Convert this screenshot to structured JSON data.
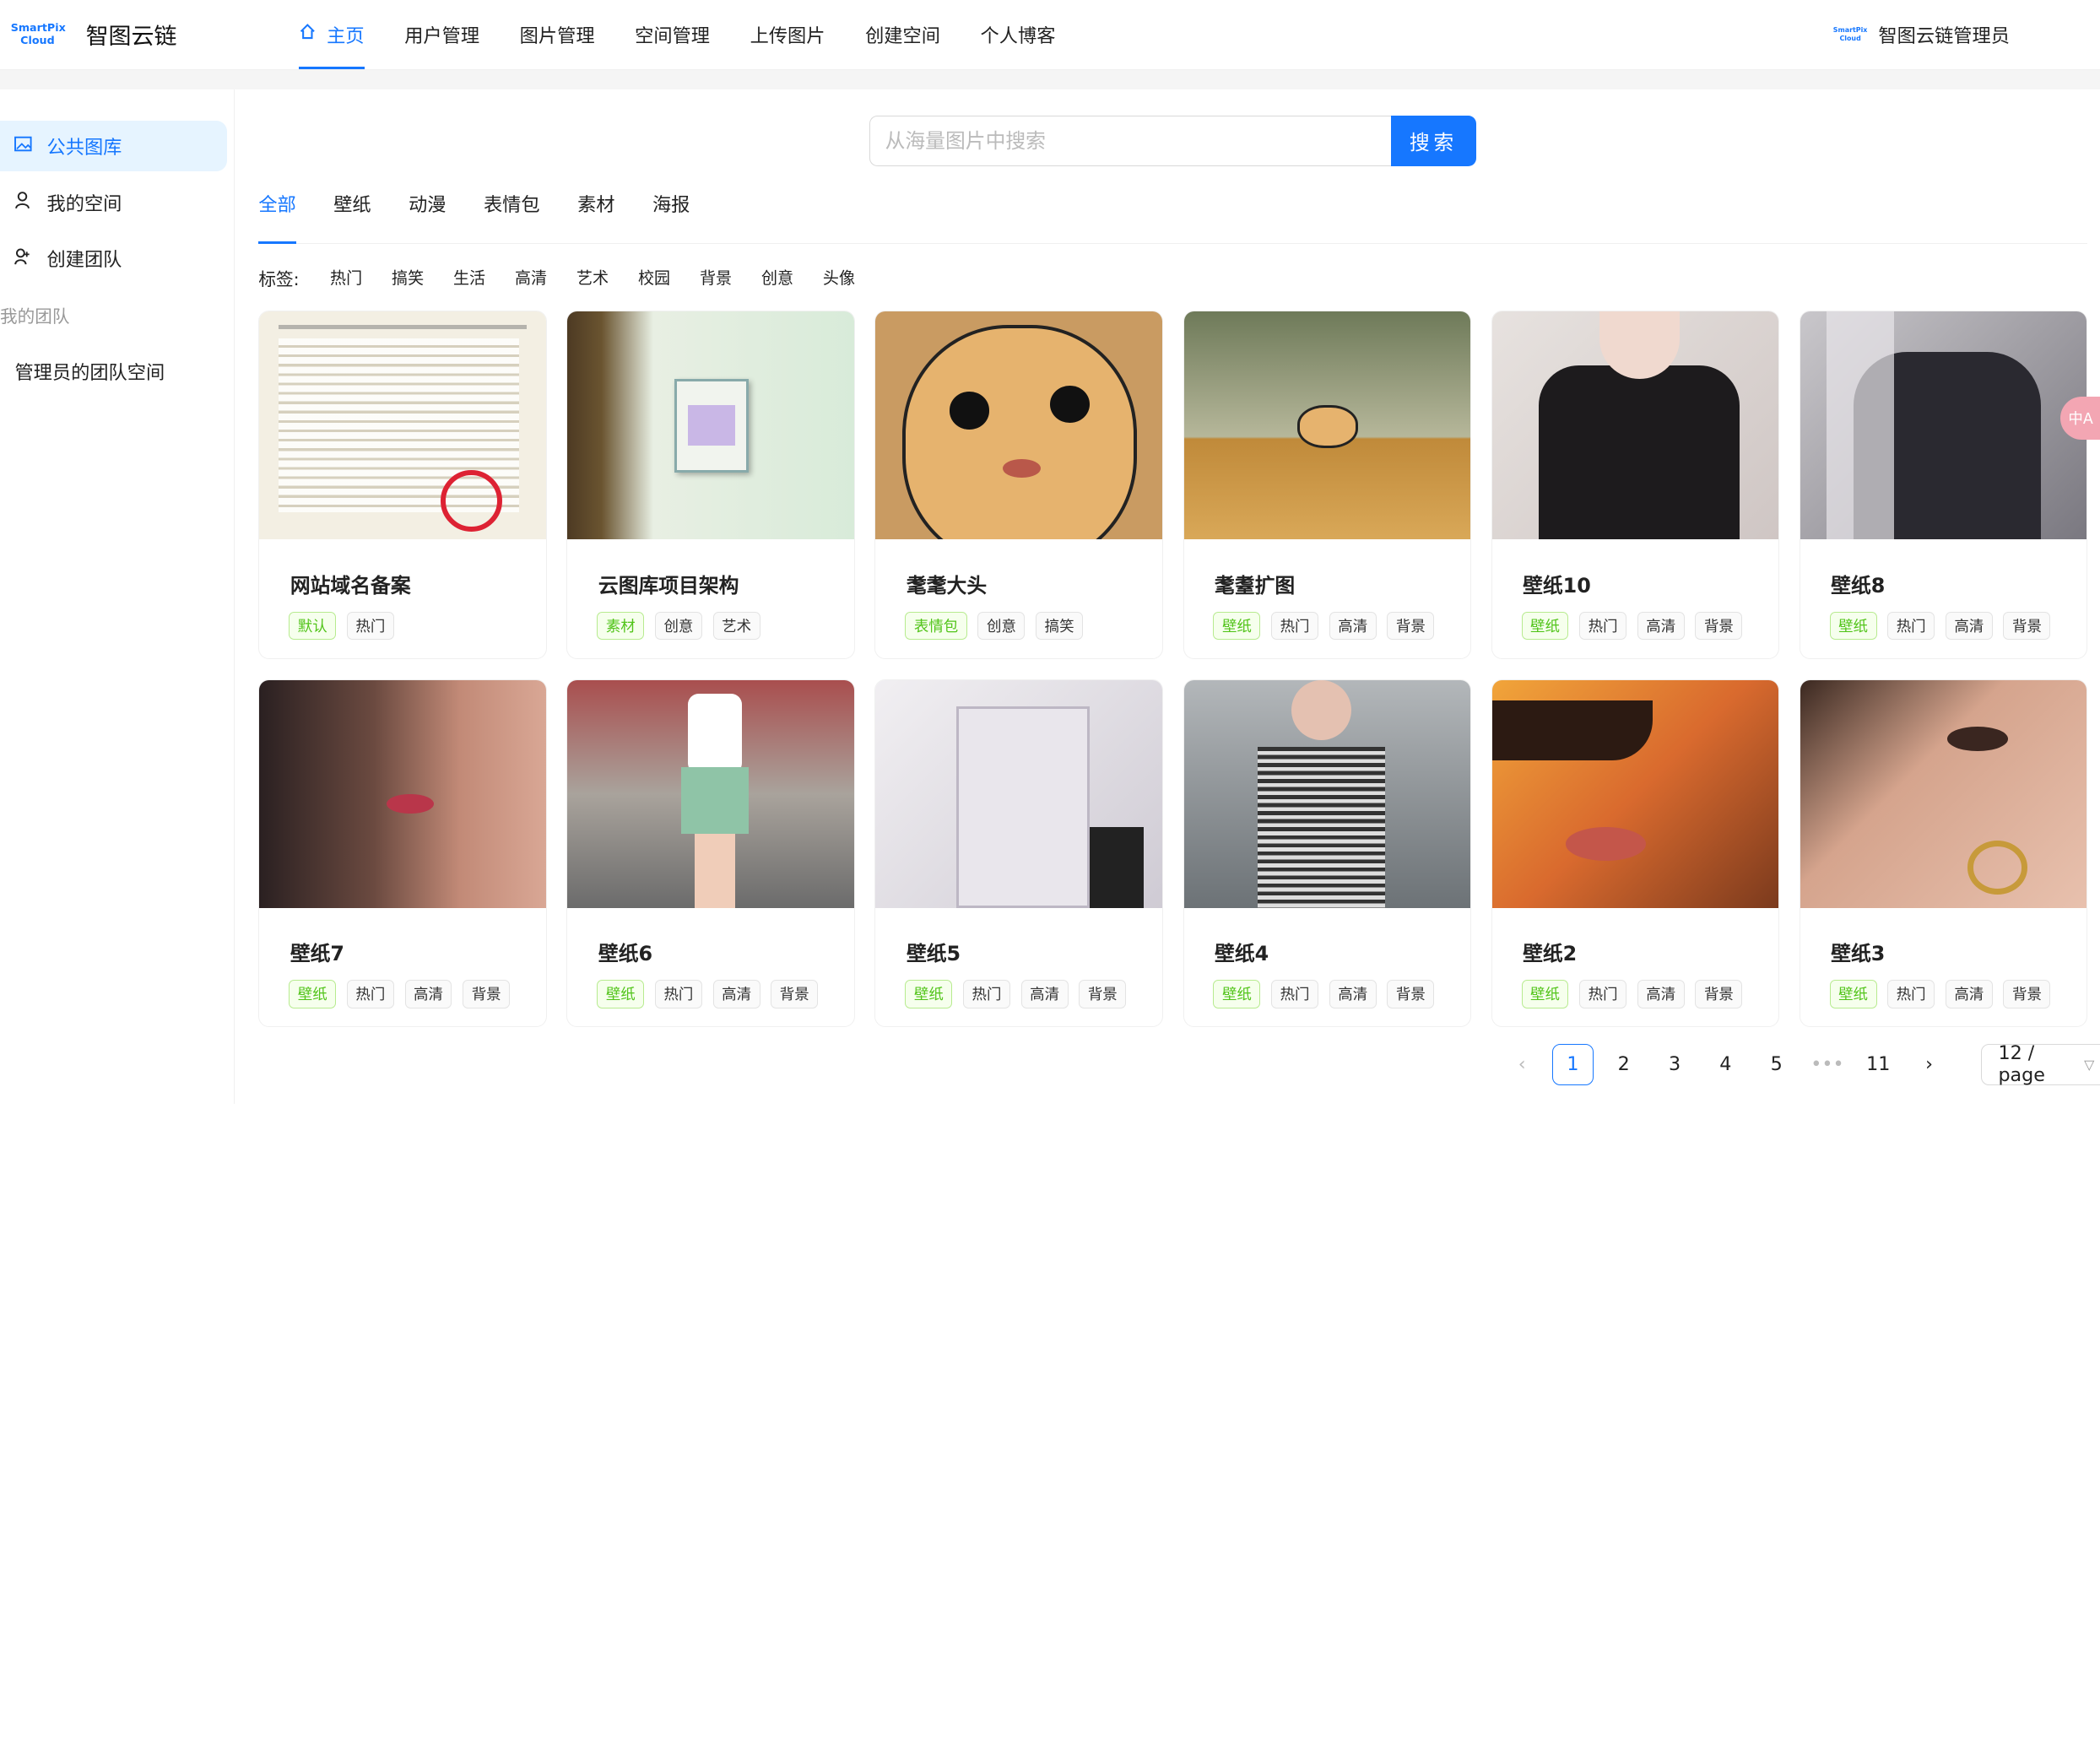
{
  "header": {
    "logo_text": "SmartPix Cloud",
    "brand": "智图云链",
    "nav": [
      {
        "label": "主页",
        "active": true
      },
      {
        "label": "用户管理"
      },
      {
        "label": "图片管理"
      },
      {
        "label": "空间管理"
      },
      {
        "label": "上传图片"
      },
      {
        "label": "创建空间"
      },
      {
        "label": "个人博客"
      }
    ],
    "user_logo_text": "SmartPix Cloud",
    "user_name": "智图云链管理员"
  },
  "sider": {
    "items": [
      {
        "label": "公共图库",
        "icon": "picture-icon",
        "active": true
      },
      {
        "label": "我的空间",
        "icon": "user-icon"
      },
      {
        "label": "创建团队",
        "icon": "team-icon"
      }
    ],
    "group_title": "我的团队",
    "group_items": [
      {
        "label": "管理员的团队空间"
      }
    ]
  },
  "search": {
    "placeholder": "从海量图片中搜索",
    "value": "",
    "button": "搜索"
  },
  "categories": [
    "全部",
    "壁纸",
    "动漫",
    "表情包",
    "素材",
    "海报"
  ],
  "tag_filter": {
    "label": "标签:",
    "tags": [
      "热门",
      "搞笑",
      "生活",
      "高清",
      "艺术",
      "校园",
      "背景",
      "创意",
      "头像"
    ]
  },
  "cards": [
    {
      "title": "网站域名备案",
      "tags": [
        "默认",
        "热门"
      ]
    },
    {
      "title": "云图库项目架构",
      "tags": [
        "素材",
        "创意",
        "艺术"
      ]
    },
    {
      "title": "耄耄大头",
      "tags": [
        "表情包",
        "创意",
        "搞笑"
      ]
    },
    {
      "title": "耄耋扩图",
      "tags": [
        "壁纸",
        "热门",
        "高清",
        "背景"
      ]
    },
    {
      "title": "壁纸10",
      "tags": [
        "壁纸",
        "热门",
        "高清",
        "背景"
      ]
    },
    {
      "title": "壁纸8",
      "tags": [
        "壁纸",
        "热门",
        "高清",
        "背景"
      ]
    },
    {
      "title": "壁纸7",
      "tags": [
        "壁纸",
        "热门",
        "高清",
        "背景"
      ]
    },
    {
      "title": "壁纸6",
      "tags": [
        "壁纸",
        "热门",
        "高清",
        "背景"
      ]
    },
    {
      "title": "壁纸5",
      "tags": [
        "壁纸",
        "热门",
        "高清",
        "背景"
      ]
    },
    {
      "title": "壁纸4",
      "tags": [
        "壁纸",
        "热门",
        "高清",
        "背景"
      ]
    },
    {
      "title": "壁纸2",
      "tags": [
        "壁纸",
        "热门",
        "高清",
        "背景"
      ]
    },
    {
      "title": "壁纸3",
      "tags": [
        "壁纸",
        "热门",
        "高清",
        "背景"
      ]
    }
  ],
  "pagination": {
    "pages": [
      "1",
      "2",
      "3",
      "4",
      "5",
      "•••",
      "11"
    ],
    "current": "1",
    "page_size": "12 / page"
  },
  "float_button": "中A",
  "colors": {
    "accent": "#1677ff",
    "active_bg": "#e6f4ff",
    "green": "#52c41a"
  }
}
